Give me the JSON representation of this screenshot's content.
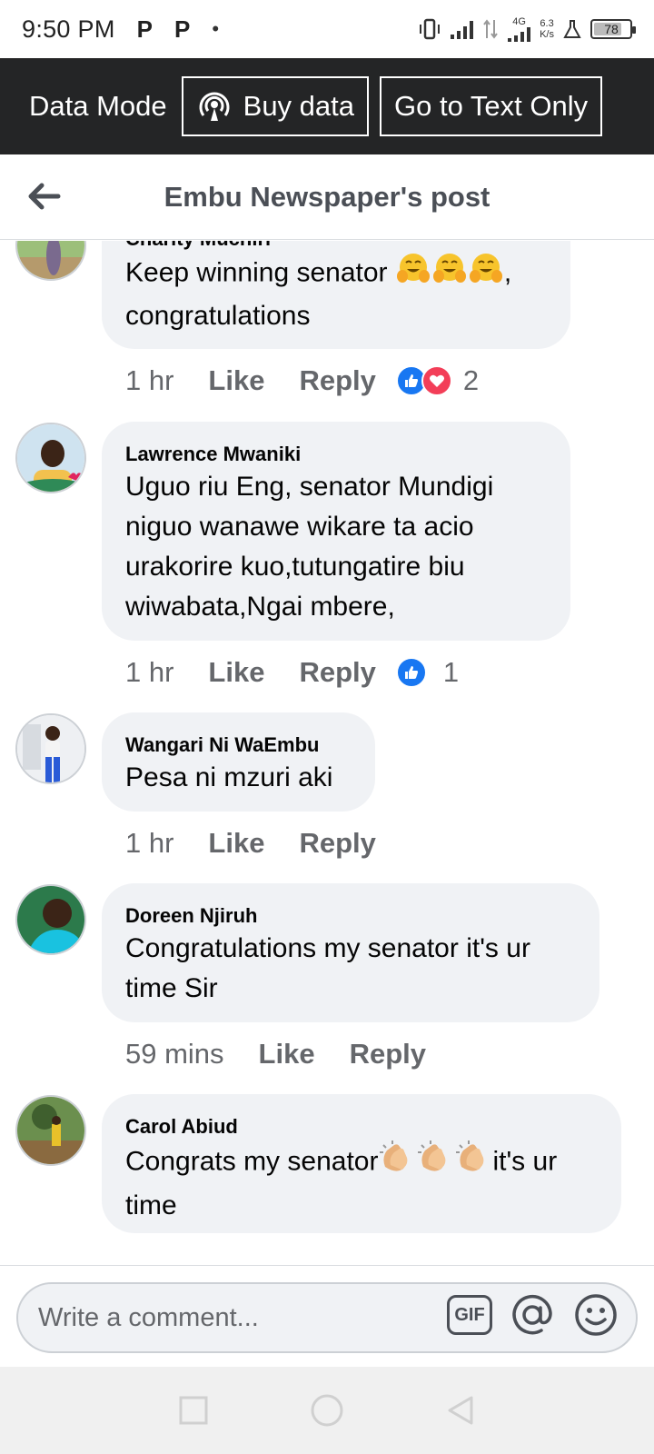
{
  "status_bar": {
    "time": "9:50 PM",
    "app_icon_1": "P",
    "app_icon_2": "P",
    "network": "4G",
    "speed_value": "6.3",
    "speed_unit": "K/s",
    "battery_level": "78",
    "battery_fraction": 0.78
  },
  "data_bar": {
    "mode_label": "Data Mode",
    "buy_label": "Buy data",
    "text_only_label": "Go to Text Only"
  },
  "header": {
    "title": "Embu Newspaper's post"
  },
  "comments": [
    {
      "name": "Charity Muchiri",
      "text_line1": "Keep winning senator",
      "text_line1_suffix": ",",
      "text_line2": "congratulations",
      "time": "1 hr",
      "like": "Like",
      "reply": "Reply",
      "reaction_count": "2"
    },
    {
      "name": "Lawrence Mwaniki",
      "text_lines": [
        "Uguo  riu Eng, senator  Mundigi",
        "niguo  wanawe wikare ta  acio",
        "urakorire kuo,tutungatire biu",
        "wiwabata,Ngai mbere,"
      ],
      "time": "1 hr",
      "like": "Like",
      "reply": "Reply",
      "reaction_count": "1"
    },
    {
      "name": "Wangari Ni WaEmbu",
      "text": "Pesa ni mzuri aki",
      "time": "1 hr",
      "like": "Like",
      "reply": "Reply"
    },
    {
      "name": "Doreen Njiruh",
      "text_line1": "Congratulations my senator it's ur",
      "text_line2": "time Sir",
      "time": "59 mins",
      "like": "Like",
      "reply": "Reply"
    },
    {
      "name": "Carol Abiud",
      "text_line1_a": "Congrats my senator",
      "text_line1_b": "it's ur",
      "text_line2": "time"
    }
  ],
  "composer": {
    "placeholder": "Write a comment...",
    "gif_label": "GIF"
  },
  "colors": {
    "data_bar_bg": "#242526",
    "bubble_bg": "#f0f2f5",
    "like_blue": "#1877f2",
    "love_red": "#f33e58",
    "meta_gray": "#65676b"
  },
  "icons": [
    "back-arrow-icon",
    "broadcast-icon",
    "like-reaction-icon",
    "love-reaction-icon",
    "hugging-face-emoji",
    "clapping-hands-emoji",
    "gif-icon",
    "mention-icon",
    "smiley-icon",
    "recent-apps-icon",
    "home-icon",
    "back-nav-icon"
  ]
}
